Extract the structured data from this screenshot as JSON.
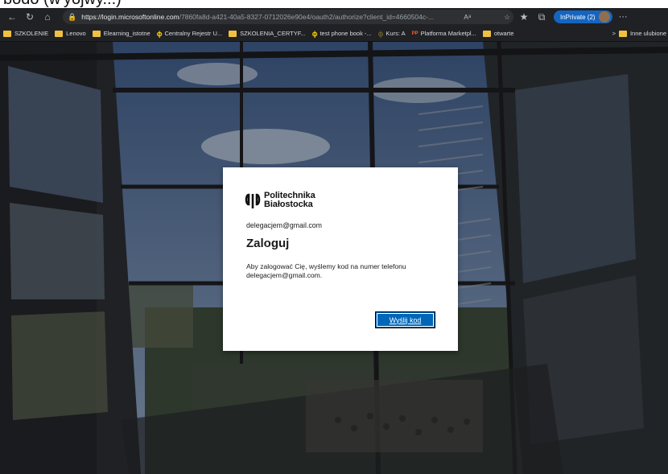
{
  "top_text": "bodo (w'yojwy...)",
  "browser": {
    "url_host": "https://login.microsoftonline.com",
    "url_rest": "/7860fa8d-a421-40a5-8327-0712026e90e4/oauth2/authorize?client_id=4660504c-...",
    "reader_icon_text": "Aᵃ",
    "inprivate_label": "InPrivate (2)",
    "more_label": "···"
  },
  "bookmarks": [
    {
      "label": "SZKOLENIE",
      "icon": "folder-icon"
    },
    {
      "label": "Lenovo",
      "icon": "folder-icon"
    },
    {
      "label": "Elearning_istotne",
      "icon": "folder-icon"
    },
    {
      "label": "Centralny Rejestr U...",
      "icon": "pb-logo-icon"
    },
    {
      "label": "SZKOLENIA_CERTYF...",
      "icon": "folder-icon"
    },
    {
      "label": "test phone book -...",
      "icon": "pb-logo-icon"
    },
    {
      "label": "Kurs: A",
      "icon": "pb-logo-icon"
    },
    {
      "label": "Platforma Marketpl...",
      "icon": "platform-icon"
    },
    {
      "label": "otwarte",
      "icon": "folder-icon"
    }
  ],
  "bookmarks_overflow": ">",
  "bookmarks_other": "Inne ulubione",
  "card": {
    "logo_line1": "Politechnika",
    "logo_line2": "Białostocka",
    "email": "delegacjem@gmail.com",
    "title": "Zaloguj",
    "description": "Aby zalogować Cię, wyślemy kod na numer telefonu delegacjem@gmail.com.",
    "button_label": "Wyślij kod"
  },
  "colors": {
    "button": "#0067b8",
    "inprivate": "#1565c0",
    "chrome": "#202124"
  }
}
